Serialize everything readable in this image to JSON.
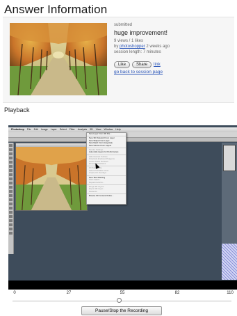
{
  "page": {
    "title": "Answer Information"
  },
  "answer": {
    "status": "submitted",
    "headline": "huge improvement!",
    "stats": "9 views / 1 likes",
    "by_prefix": "by",
    "author": "photoshopper",
    "when": "2 weeks ago",
    "session_length": "session length: 7 minutes",
    "like_label": "Like",
    "share_label": "Share",
    "link_label": "link",
    "back_label": "go back to session page",
    "image_icon": "autumn-tree-alley-image"
  },
  "playback": {
    "title": "Playback",
    "screen": {
      "menubar": [
        "Photoshop",
        "File",
        "Edit",
        "Image",
        "Layer",
        "Select",
        "Filter",
        "Analysis",
        "3D",
        "View",
        "Window",
        "Help"
      ],
      "menu_items": [
        "New Layer From 3D File...",
        "New 3D Postcard From Layer",
        "New Shape From Layer",
        "New Mesh From Grayscale",
        "New Volume From Layers",
        "Render Settings...",
        "Auto-Hide Layers for Performance",
        "Hide Nearest Surface",
        "Only Hide Enclosed Polygons",
        "Invert Visible Surfaces",
        "Reveal All Surfaces",
        "3D Paint Mode",
        "Select Paintable Areas",
        "Create UV Overlays",
        "New Tiled Painting",
        "Paint Falloff...",
        "Reparameterize...",
        "Merge 3D Layers",
        "Export 3D Layer...",
        "Rasterize",
        "Browse 3D Content Online..."
      ],
      "dim_items": [
        5,
        7,
        8,
        9,
        10,
        11,
        12,
        13,
        15,
        16,
        17,
        18,
        19
      ]
    },
    "timeline": {
      "ticks": [
        "0",
        "27",
        "55",
        "82",
        "110"
      ],
      "current": 55,
      "max": 110
    },
    "control_label": "Pause/Stop the Recording"
  }
}
